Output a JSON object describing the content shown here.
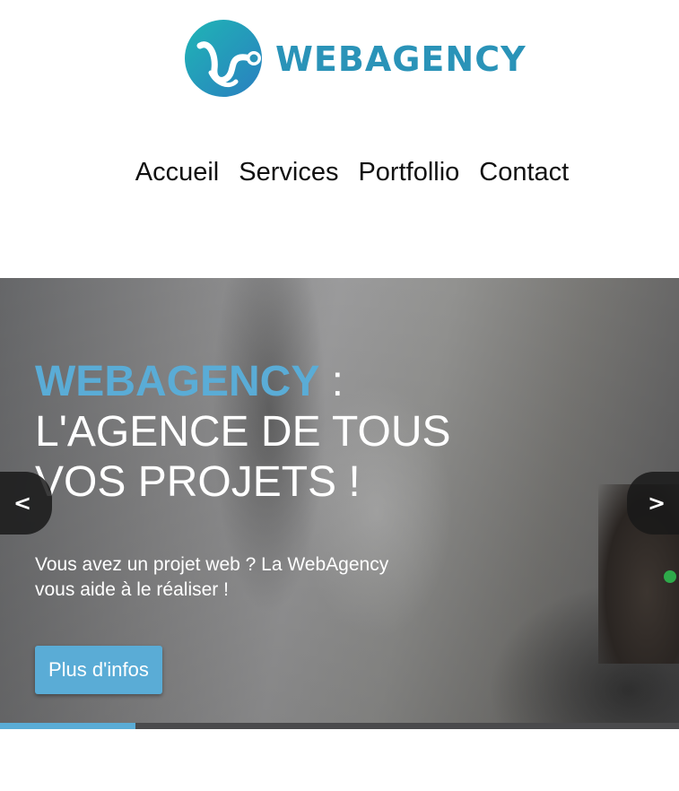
{
  "header": {
    "logo_text": "WEBAGENCY"
  },
  "nav": {
    "items": [
      "Accueil",
      "Services",
      "Portfollio",
      "Contact"
    ]
  },
  "hero": {
    "title_brand": "WEBAGENCY",
    "title_colon": " :",
    "title_line2": "L'AGENCE DE TOUS",
    "title_line3": "VOS PROJETS !",
    "subtitle": "Vous avez un projet web ? La WebAgency vous aide à le réaliser !",
    "button_label": "Plus d'infos",
    "prev_label": "<",
    "next_label": ">",
    "progress": 0.2
  },
  "colors": {
    "accent": "#5aacd6",
    "logo_text": "#2a93b8",
    "logo_gradient_start": "#1fb5b5",
    "logo_gradient_end": "#2a7fc0"
  },
  "icons": {
    "logo": "webagency-logo-icon",
    "prev": "chevron-left-icon",
    "next": "chevron-right-icon"
  }
}
